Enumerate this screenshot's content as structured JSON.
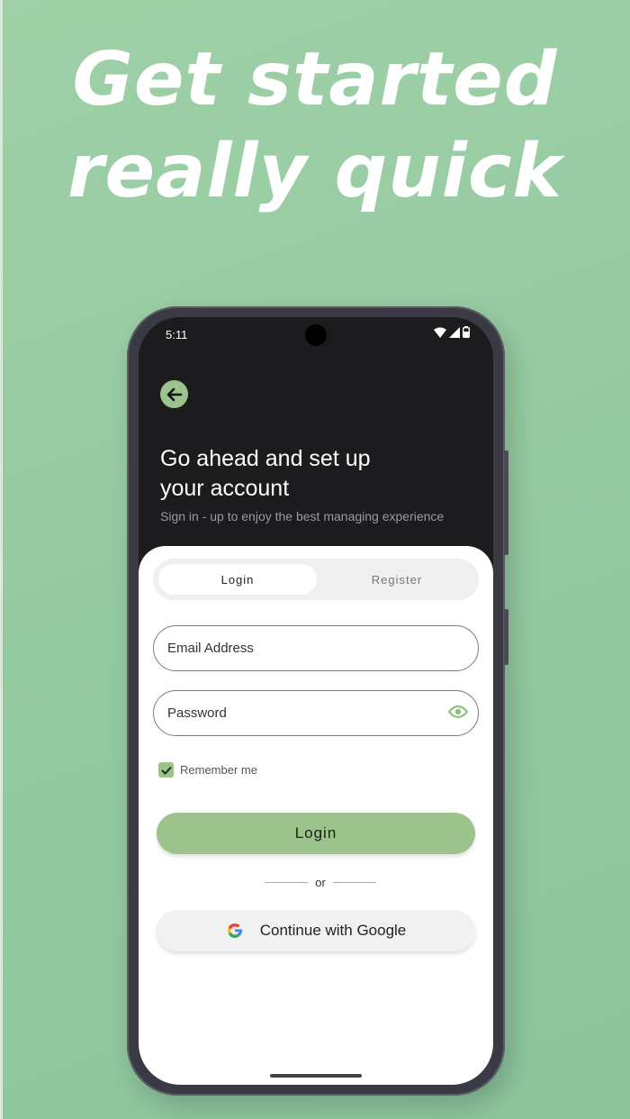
{
  "promo": {
    "headline_line1": "Get started",
    "headline_line2": "really quick"
  },
  "status_bar": {
    "time": "5:11",
    "icons": [
      "wifi-icon",
      "signal-icon",
      "battery-icon"
    ]
  },
  "header": {
    "back_icon": "arrow-left-icon",
    "title_line1": "Go ahead and set up",
    "title_line2": "your account",
    "subtitle": "Sign in - up to enjoy the best managing experience"
  },
  "tabs": [
    {
      "label": "Login",
      "selected": true
    },
    {
      "label": "Register",
      "selected": false
    }
  ],
  "form": {
    "email_placeholder": "Email Address",
    "email_value": "",
    "password_placeholder": "Password",
    "password_value": "",
    "password_toggle_icon": "eye-icon",
    "remember_label": "Remember me",
    "remember_checked": true,
    "login_label": "Login",
    "divider_text": "or",
    "google_label": "Continue with Google"
  },
  "colors": {
    "accent": "#9cc38c",
    "background": "#93c9a0",
    "screen_dark": "#1c1c1e"
  }
}
